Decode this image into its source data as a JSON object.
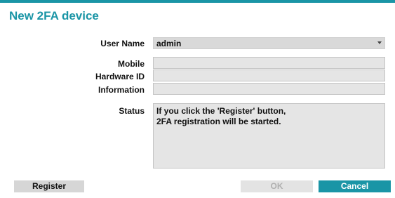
{
  "dialog": {
    "title": "New 2FA device",
    "accent_color": "#1a95a6"
  },
  "form": {
    "user_name": {
      "label": "User Name",
      "value": "admin",
      "icon": "chevron-down-icon"
    },
    "mobile": {
      "label": "Mobile",
      "value": ""
    },
    "hardware_id": {
      "label": "Hardware ID",
      "value": ""
    },
    "information": {
      "label": "Information",
      "value": ""
    },
    "status": {
      "label": "Status",
      "lines": [
        "If you click the 'Register' button,",
        "2FA registration will be started."
      ]
    }
  },
  "buttons": {
    "register": "Register",
    "ok": "OK",
    "cancel": "Cancel"
  }
}
